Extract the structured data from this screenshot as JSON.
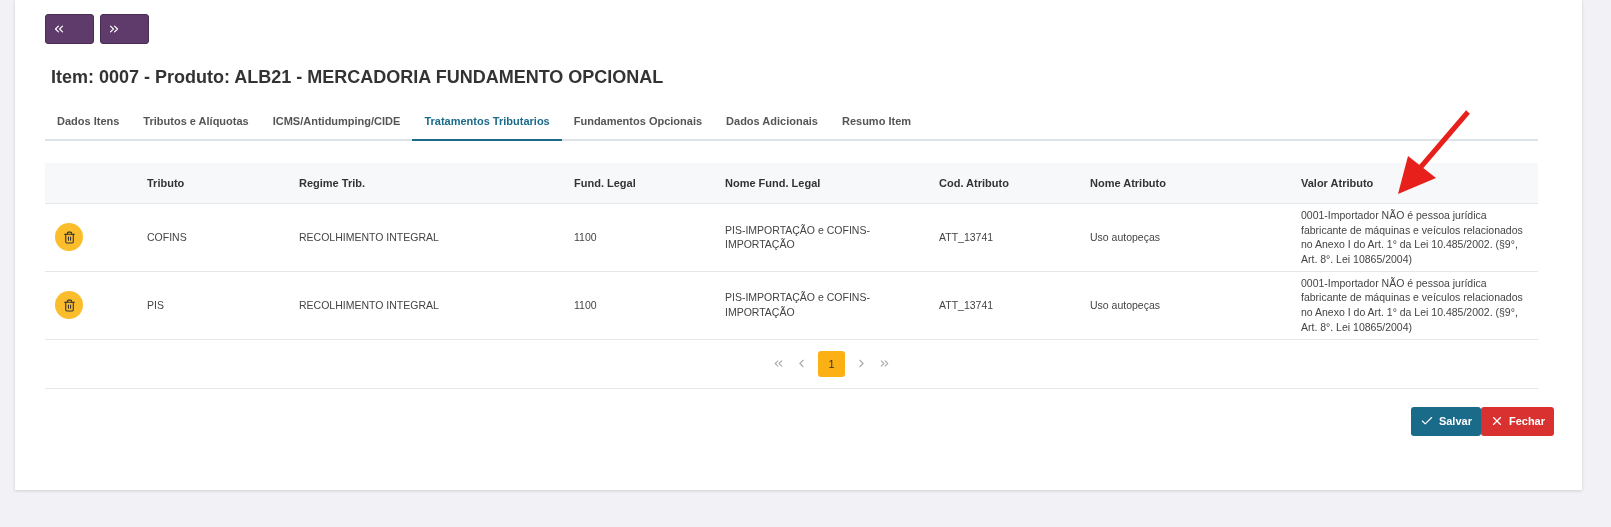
{
  "title": "Item: 0007 - Produto: ALB21 - MERCADORIA FUNDAMENTO OPCIONAL",
  "tabs": [
    {
      "label": "Dados Itens",
      "selected": false
    },
    {
      "label": "Tributos e Alíquotas",
      "selected": false
    },
    {
      "label": "ICMS/Antidumping/CIDE",
      "selected": false
    },
    {
      "label": "Tratamentos Tributarios",
      "selected": true
    },
    {
      "label": "Fundamentos Opcionais",
      "selected": false
    },
    {
      "label": "Dados Adicionais",
      "selected": false
    },
    {
      "label": "Resumo Item",
      "selected": false
    }
  ],
  "table": {
    "columns": [
      "Tributo",
      "Regime Trib.",
      "Fund. Legal",
      "Nome Fund. Legal",
      "Cod. Atributo",
      "Nome Atributo",
      "Valor Atributo"
    ],
    "rows": [
      [
        "COFINS",
        "RECOLHIMENTO INTEGRAL",
        "1100",
        "PIS-IMPORTAÇÃO e COFINS-IMPORTAÇÃO",
        "ATT_13741",
        "Uso autopeças",
        "0001-Importador NÃO é pessoa jurídica fabricante de máquinas e veículos relacionados no Anexo I do Art. 1° da Lei 10.485/2002. (§9°, Art. 8°. Lei 10865/2004)"
      ],
      [
        "PIS",
        "RECOLHIMENTO INTEGRAL",
        "1100",
        "PIS-IMPORTAÇÃO e COFINS-IMPORTAÇÃO",
        "ATT_13741",
        "Uso autopeças",
        "0001-Importador NÃO é pessoa jurídica fabricante de máquinas e veículos relacionados no Anexo I do Art. 1° da Lei 10.485/2002. (§9°, Art. 8°. Lei 10865/2004)"
      ]
    ]
  },
  "pagination": {
    "pages": [
      {
        "label": "1",
        "selected": true
      }
    ]
  },
  "buttons": [
    {
      "label": "Salvar",
      "kind": "save"
    },
    {
      "label": "Fechar",
      "kind": "close"
    }
  ]
}
